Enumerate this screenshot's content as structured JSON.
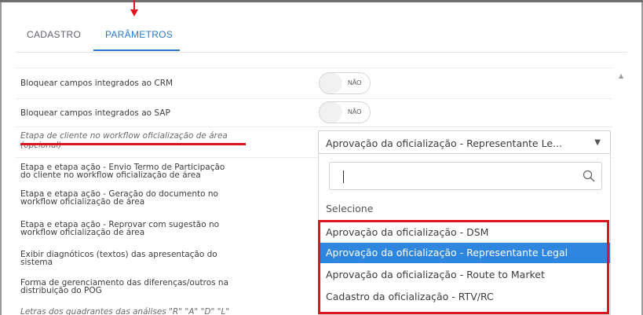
{
  "tabs": [
    {
      "label": "CADASTRO"
    },
    {
      "label": "PARÂMETROS"
    }
  ],
  "colors": {
    "active_tab": "#2a78c8",
    "selected_option": "#2e86de",
    "annotation_red": "#e0141e"
  },
  "rows": [
    {
      "label": "Bloquear campos integrados ao CRM",
      "toggle": "NÃO"
    },
    {
      "label": "Bloquear campos integrados ao SAP",
      "toggle": "NÃO"
    },
    {
      "label": "Etapa de cliente no workflow oficialização de área",
      "label_suffix": "(opcional)"
    },
    {
      "label_line1": "Etapa e etapa ação - Envio Termo de Participação",
      "label_line2": "do cliente no workflow oficialização de área"
    },
    {
      "label_line1": "Etapa e etapa ação - Geração do documento no",
      "label_line2": "workflow oficialização de área"
    },
    {
      "label_line1": "Etapa e etapa ação - Reprovar com sugestão no",
      "label_line2": "workflow oficialização de área"
    },
    {
      "label_line1": "Exibir diagnóticos (textos) das apresentação do",
      "label_line2": "sistema"
    },
    {
      "label_line1": "Forma de gerenciamento das diferenças/outros na",
      "label_line2": "distribuição do POG"
    },
    {
      "label": "Letras dos quadrantes das análises \"R\" \"A\" \"D\" \"L\""
    }
  ],
  "select": {
    "value": "Aprovação da oficialização - Representante Le...",
    "caret": "▼"
  },
  "dropdown": {
    "search_icon": "search-icon",
    "placeholder_option": "Selecione",
    "options": [
      "Aprovação da oficialização - DSM",
      "Aprovação da oficialização - Representante Legal",
      "Aprovação da oficialização - Route to Market",
      "Cadastro da oficialização - RTV/RC"
    ],
    "selected_index": 1
  },
  "partial_bottom": "RADL"
}
